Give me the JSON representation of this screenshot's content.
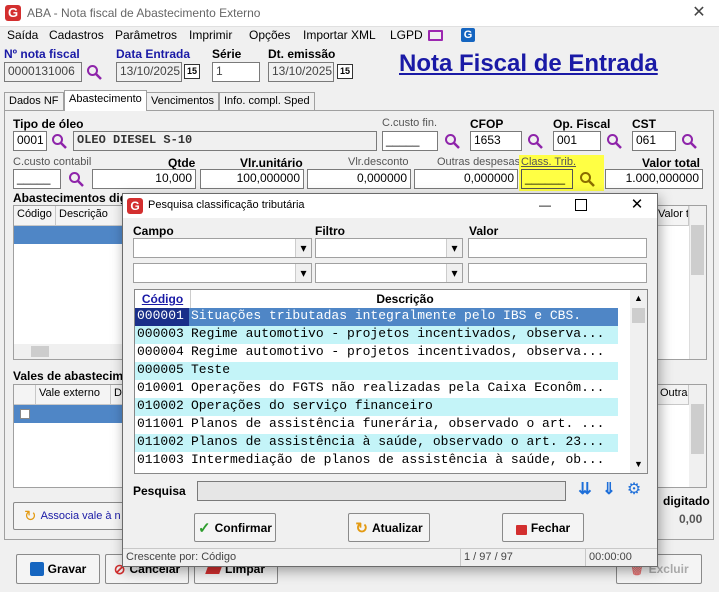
{
  "window": {
    "title": "ABA - Nota fiscal de Abastecimento Externo",
    "app_logo": "G"
  },
  "menu": [
    "Saída",
    "Cadastros",
    "Parâmetros",
    "Imprimir",
    "Opções",
    "Importar XML",
    "LGPD"
  ],
  "header": {
    "nota_label": "Nº nota fiscal",
    "nota_value": "0000131006",
    "data_entrada_label": "Data Entrada",
    "data_entrada_value": "13/10/2025",
    "serie_label": "Série",
    "serie_value": "1",
    "dt_emissao_label": "Dt. emissão",
    "dt_emissao_value": "13/10/2025",
    "big_title": "Nota Fiscal de Entrada",
    "cal_icon": "15"
  },
  "tabs": [
    "Dados NF",
    "Abastecimento",
    "Vencimentos",
    "Info. compl. Sped"
  ],
  "form": {
    "tipo_oleo_label": "Tipo de óleo",
    "tipo_oleo_code": "0001",
    "tipo_oleo_desc": "OLEO DIESEL S-10",
    "ccusto_fin_label": "C.custo fin.",
    "ccusto_fin_value": "_____",
    "cfop_label": "CFOP",
    "cfop_value": "1653",
    "op_fiscal_label": "Op. Fiscal",
    "op_fiscal_value": "001",
    "cst_label": "CST",
    "cst_value": "061",
    "ccusto_contabil_label": "C.custo contabil",
    "ccusto_contabil_value": "_____",
    "qtde_label": "Qtde",
    "qtde_value": "10,000",
    "vlr_unit_label": "Vlr.unitário",
    "vlr_unit_value": "100,000000",
    "vlr_desc_label": "Vlr.desconto",
    "vlr_desc_value": "0,000000",
    "outras_label": "Outras despesas",
    "outras_value": "0,000000",
    "class_trib_label": "Class. Trib.",
    "class_trib_value": "______",
    "valor_total_label": "Valor total",
    "valor_total_value": "1.000,000000"
  },
  "abastecimentos": {
    "label": "Abastecimentos digi",
    "col_codigo": "Código",
    "col_descricao": "Descrição",
    "col_vlr": "Valor to"
  },
  "vales": {
    "label": "Vales de abasteciment",
    "col_vale": "Vale externo",
    "col_d": "D",
    "col_outras": "Outras",
    "associa_label": "Associa vale à n",
    "digitado_label": "digitado",
    "digitado_value": "0,00"
  },
  "bottom_buttons": {
    "gravar": "Gravar",
    "cancelar": "Cancelar",
    "limpar": "Limpar",
    "excluir": "Excluir"
  },
  "dialog": {
    "title": "Pesquisa classificação tributária",
    "campo_label": "Campo",
    "filtro_label": "Filtro",
    "valor_label": "Valor",
    "grid_col_codigo": "Código",
    "grid_col_descricao": "Descrição",
    "rows": [
      {
        "codigo": "000001",
        "descricao": "Situações tributadas integralmente pelo IBS e CBS."
      },
      {
        "codigo": "000003",
        "descricao": "Regime automotivo - projetos incentivados, observa..."
      },
      {
        "codigo": "000004",
        "descricao": "Regime automotivo - projetos incentivados, observa..."
      },
      {
        "codigo": "000005",
        "descricao": "Teste"
      },
      {
        "codigo": "010001",
        "descricao": "Operações do FGTS não realizadas pela Caixa Econôm..."
      },
      {
        "codigo": "010002",
        "descricao": "Operações do serviço financeiro"
      },
      {
        "codigo": "011001",
        "descricao": "Planos de assistência funerária, observado o art. ..."
      },
      {
        "codigo": "011002",
        "descricao": "Planos de assistência à saúde, observado o art. 23..."
      },
      {
        "codigo": "011003",
        "descricao": "Intermediação de planos de assistência à saúde, ob..."
      }
    ],
    "pesquisa_label": "Pesquisa",
    "pesquisa_value": "",
    "confirmar": "Confirmar",
    "atualizar": "Atualizar",
    "fechar": "Fechar",
    "status_order": "Crescente por: Código",
    "status_count": "1 / 97 / 97",
    "status_time": "00:00:00"
  },
  "colors": {
    "accent_blue": "#1a1aa6",
    "row_selected": "#4f86c6",
    "row_alt": "#c4f4f8",
    "highlight_yellow": "#ffff44",
    "big_title_blue": "#1a1aa6"
  }
}
